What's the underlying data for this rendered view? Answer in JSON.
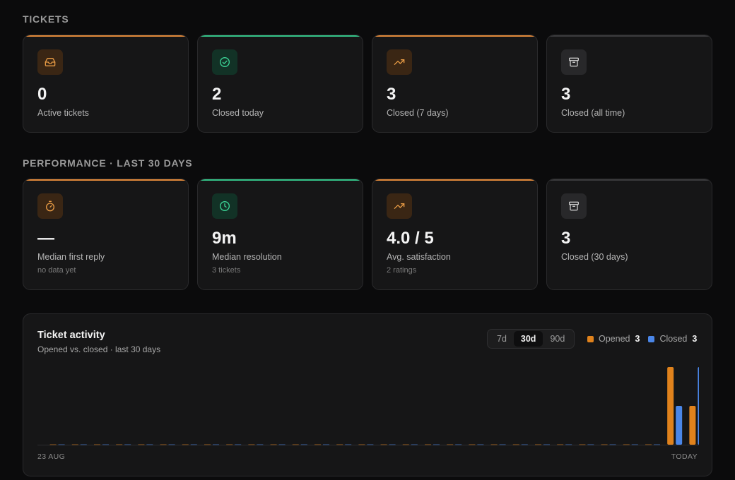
{
  "sections": {
    "tickets_title": "TICKETS",
    "performance_title": "PERFORMANCE · LAST 30 DAYS"
  },
  "colors": {
    "accent_orange": "#e48a3a",
    "accent_green": "#34c58a",
    "opened": "#e0821c",
    "closed": "#4a86e8"
  },
  "tickets": [
    {
      "icon": "inbox-icon",
      "accent": "orange",
      "value": "0",
      "label": "Active tickets"
    },
    {
      "icon": "check-circle-icon",
      "accent": "green",
      "value": "2",
      "label": "Closed today"
    },
    {
      "icon": "trending-up-icon",
      "accent": "orange",
      "value": "3",
      "label": "Closed (7 days)"
    },
    {
      "icon": "archive-icon",
      "accent": "grey",
      "value": "3",
      "label": "Closed (all time)"
    }
  ],
  "performance": [
    {
      "icon": "stopwatch-icon",
      "accent": "orange",
      "value": "—",
      "label": "Median first reply",
      "sub": "no data yet"
    },
    {
      "icon": "clock-icon",
      "accent": "green",
      "value": "9m",
      "label": "Median resolution",
      "sub": "3 tickets"
    },
    {
      "icon": "trending-up-icon",
      "accent": "orange",
      "value": "4.0 / 5",
      "label": "Avg. satisfaction",
      "sub": "2 ratings"
    },
    {
      "icon": "archive-icon",
      "accent": "grey",
      "value": "3",
      "label": "Closed (30 days)"
    }
  ],
  "activity": {
    "title": "Ticket activity",
    "subtitle": "Opened vs. closed · last 30 days",
    "range_tabs": [
      "7d",
      "30d",
      "90d"
    ],
    "active_range": "30d",
    "legend": [
      {
        "name": "Opened",
        "count": "3"
      },
      {
        "name": "Closed",
        "count": "3"
      }
    ],
    "x_start_label": "23 AUG",
    "x_end_label": "TODAY"
  },
  "chart_data": {
    "type": "bar",
    "title": "Ticket activity",
    "x_start": "23 AUG",
    "x_end": "TODAY",
    "ylim": [
      0,
      2
    ],
    "grid": false,
    "legend_position": "top-right",
    "series": [
      {
        "name": "Opened",
        "values": [
          0,
          0,
          0,
          0,
          0,
          0,
          0,
          0,
          0,
          0,
          0,
          0,
          0,
          0,
          0,
          0,
          0,
          0,
          0,
          0,
          0,
          0,
          0,
          0,
          0,
          0,
          0,
          0,
          2,
          1
        ]
      },
      {
        "name": "Closed",
        "values": [
          0,
          0,
          0,
          0,
          0,
          0,
          0,
          0,
          0,
          0,
          0,
          0,
          0,
          0,
          0,
          0,
          0,
          0,
          0,
          0,
          0,
          0,
          0,
          0,
          0,
          0,
          0,
          0,
          1,
          2
        ]
      }
    ]
  }
}
